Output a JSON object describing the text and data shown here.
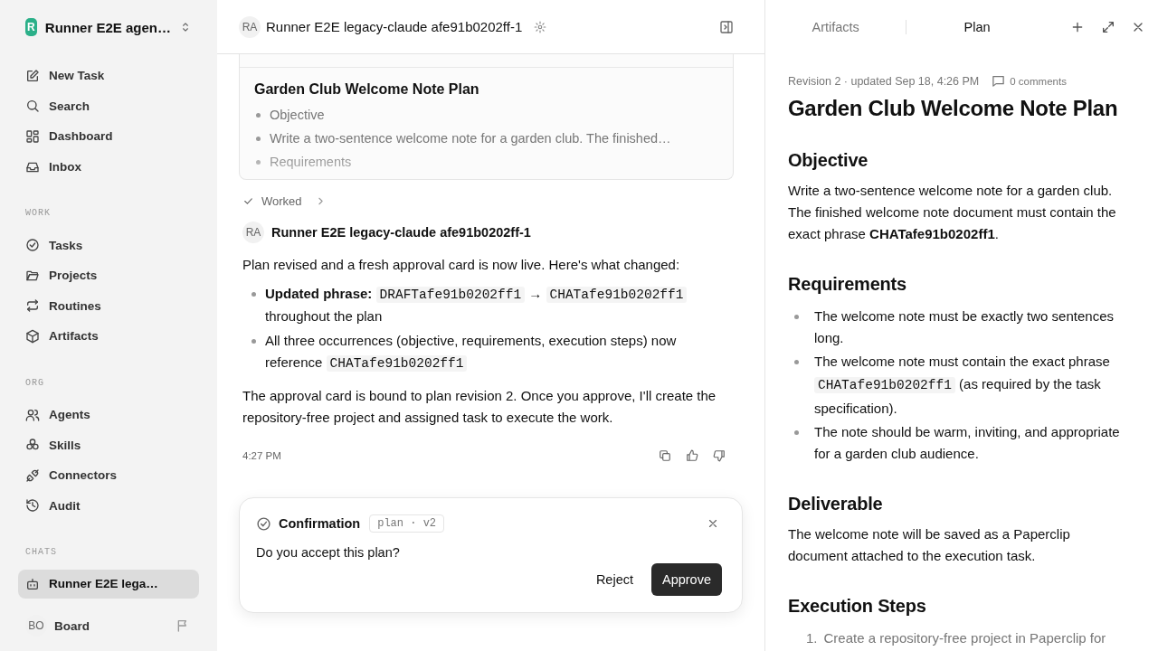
{
  "workspace": {
    "initial": "R",
    "name": "Runner E2E agen…"
  },
  "sidebar": {
    "nav": [
      {
        "label": "New Task",
        "kind": "edit",
        "selected": false
      },
      {
        "label": "Search",
        "kind": "search",
        "selected": false
      },
      {
        "label": "Dashboard",
        "kind": "grid",
        "selected": false
      },
      {
        "label": "Inbox",
        "kind": "inbox",
        "selected": false
      }
    ],
    "sections": [
      {
        "title": "WORK",
        "items": [
          {
            "label": "Tasks",
            "kind": "check",
            "selected": false
          },
          {
            "label": "Projects",
            "kind": "folder",
            "selected": false
          },
          {
            "label": "Routines",
            "kind": "repeat",
            "selected": false
          },
          {
            "label": "Artifacts",
            "kind": "box",
            "selected": false
          }
        ]
      },
      {
        "title": "ORG",
        "items": [
          {
            "label": "Agents",
            "kind": "users",
            "selected": false
          },
          {
            "label": "Skills",
            "kind": "blocks",
            "selected": false
          },
          {
            "label": "Connectors",
            "kind": "plug",
            "selected": false
          },
          {
            "label": "Audit",
            "kind": "history",
            "selected": false
          }
        ]
      },
      {
        "title": "CHATS",
        "items": [
          {
            "label": "Runner E2E lega…",
            "kind": "bot",
            "selected": true
          }
        ]
      }
    ]
  },
  "user": {
    "initials": "BO",
    "name": "Board"
  },
  "header": {
    "initials": "RA",
    "title": "Runner E2E legacy-claude afe91b0202ff-1"
  },
  "plan_card": {
    "title": "Garden Club Welcome Note Plan",
    "items": [
      "Objective",
      "Write a two-sentence welcome note for a garden club. The finished…",
      "Requirements"
    ]
  },
  "status": {
    "label": "Worked"
  },
  "message": {
    "initials": "RA",
    "author": "Runner E2E legacy-claude afe91b0202ff-1",
    "intro": "Plan revised and a fresh approval card is now live. Here's what changed:",
    "bullets": [
      [
        {
          "kind": "bold",
          "text": "Updated phrase:"
        },
        {
          "kind": "code",
          "text": "DRAFTafe91b0202ff1"
        },
        {
          "kind": "text",
          "text": "→"
        },
        {
          "kind": "code",
          "text": "CHATafe91b0202ff1"
        },
        {
          "kind": "text",
          "text": "throughout the plan"
        }
      ],
      [
        {
          "kind": "text",
          "text": "All three occurrences (objective, requirements, execution steps) now reference"
        },
        {
          "kind": "code",
          "text": "CHATafe91b0202ff1"
        }
      ]
    ],
    "outro": "The approval card is bound to plan revision 2. Once you approve, I'll create the repository-free project and assigned task to execute the work.",
    "time": "4:27 PM"
  },
  "confirmation": {
    "title": "Confirmation",
    "tag": "plan · v2",
    "question": "Do you accept this plan?",
    "buttons": [
      {
        "label": "Reject",
        "kind": "secondary"
      },
      {
        "label": "Approve",
        "kind": "primary"
      }
    ]
  },
  "panel": {
    "tabs": [
      {
        "label": "Artifacts",
        "selected": false
      },
      {
        "label": "Plan",
        "selected": true
      }
    ],
    "meta": "Revision 2 · updated Sep 18, 4:26 PM",
    "comments": "0 comments",
    "title": "Garden Club Welcome Note Plan",
    "sections": [
      {
        "heading": "Objective",
        "blocks": [
          {
            "kind": "paragraph",
            "text": "Write a two-sentence welcome note for a garden club. The finished welcome note document must contain the exact phrase **CHATafe91b0202ff1**."
          }
        ]
      },
      {
        "heading": "Requirements",
        "blocks": [
          {
            "kind": "bullets",
            "items": [
              [
                {
                  "kind": "text",
                  "text": "The welcome note must be exactly two sentences long."
                }
              ],
              [
                {
                  "kind": "text",
                  "text": "The welcome note must contain the exact phrase"
                },
                {
                  "kind": "code",
                  "text": "CHATafe91b0202ff1"
                },
                {
                  "kind": "text",
                  "text": "(as required by the task specification)."
                }
              ],
              [
                {
                  "kind": "text",
                  "text": "The note should be warm, inviting, and appropriate for a garden club audience."
                }
              ]
            ]
          }
        ]
      },
      {
        "heading": "Deliverable",
        "blocks": [
          {
            "kind": "paragraph",
            "text": "The welcome note will be saved as a Paperclip document attached to the execution task."
          }
        ]
      },
      {
        "heading": "Execution Steps",
        "blocks": [
          {
            "kind": "numbered",
            "items": [
              {
                "number": "1.",
                "text": "Create a repository-free project in Paperclip for"
              }
            ]
          }
        ]
      }
    ]
  }
}
